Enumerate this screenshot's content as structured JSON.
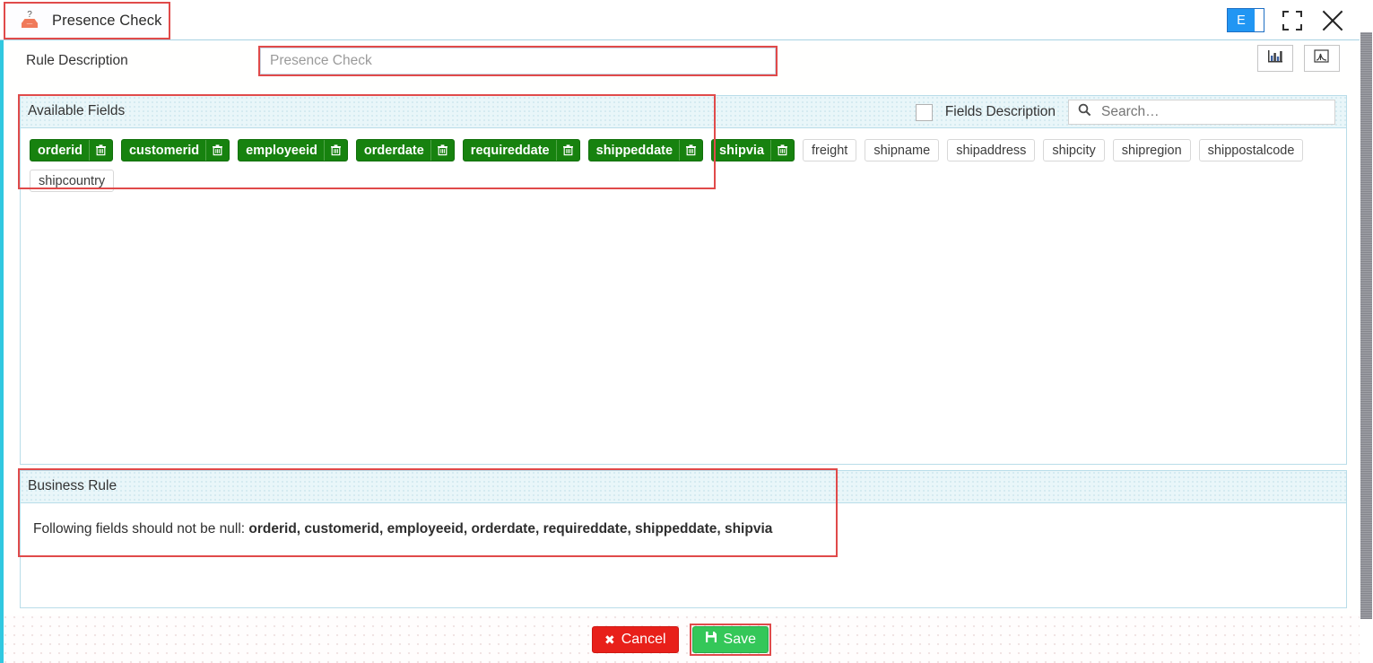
{
  "window": {
    "tab_title": "Presence Check",
    "tab_icon": "inbox-question-icon",
    "badge_label": "E",
    "maximize_icon": "maximize-icon",
    "close_icon": "close-icon"
  },
  "description": {
    "label": "Rule Description",
    "value": "Presence Check",
    "placeholder": "Presence Check"
  },
  "toolbar": {
    "bar_chart_icon": "bar-chart-icon",
    "distribution_chart_icon": "distribution-chart-icon"
  },
  "fields_panel": {
    "title": "Available Fields",
    "fields_description_label": "Fields Description",
    "fields_description_checked": false,
    "search_placeholder": "Search…",
    "search_value": "",
    "search_icon": "search-icon",
    "selected_fields": [
      "orderid",
      "customerid",
      "employeeid",
      "orderdate",
      "requireddate",
      "shippeddate",
      "shipvia"
    ],
    "available_fields": [
      "freight",
      "shipname",
      "shipaddress",
      "shipcity",
      "shipregion",
      "shippostalcode",
      "shipcountry"
    ],
    "delete_icon": "trash-icon"
  },
  "business_rule": {
    "title": "Business Rule",
    "text_prefix": "Following fields should not be null:",
    "text_fields": "orderid, customerid, employeeid, orderdate, requireddate, shippeddate, shipvia"
  },
  "footer": {
    "cancel_label": "Cancel",
    "cancel_icon": "cross-icon",
    "save_label": "Save",
    "save_icon": "floppy-disk-icon"
  },
  "colors": {
    "accent_rail": "#31c8e0",
    "panel_header": "#e9f6f9",
    "tag_selected": "#17820f",
    "cancel": "#e8201a",
    "save": "#34c759",
    "highlight": "#e04a4a",
    "badge": "#2196f3"
  }
}
